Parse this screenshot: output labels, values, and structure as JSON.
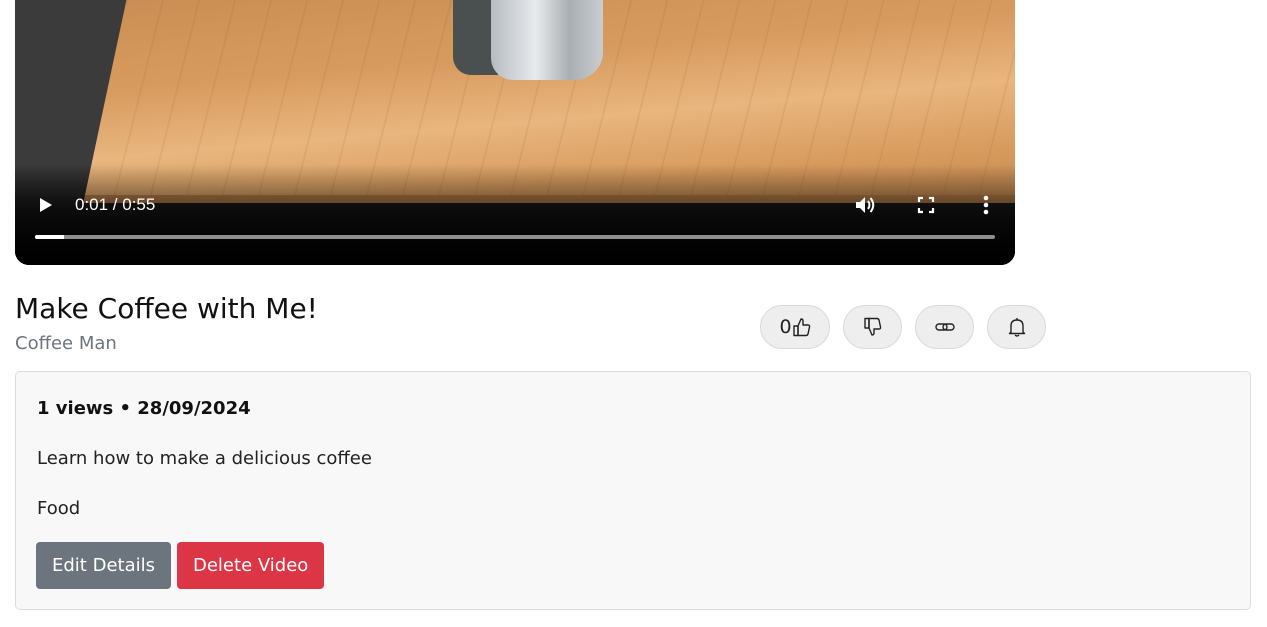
{
  "player": {
    "time": "0:01 / 0:55",
    "progress": 0.03,
    "play_icon": "play-icon",
    "volume_icon": "volume-icon",
    "fullscreen_icon": "fullscreen-icon",
    "more_icon": "more-vertical-icon"
  },
  "video": {
    "title": "Make Coffee with Me!",
    "channel": "Coffee Man",
    "likes": "0",
    "meta": "1 views • 28/09/2024",
    "description": "Learn how to make a delicious coffee",
    "category": "Food"
  },
  "actions": {
    "edit_label": "Edit Details",
    "delete_label": "Delete Video"
  },
  "colors": {
    "edit": "#6c757d",
    "delete": "#dc3545",
    "channel_text": "#6c757d"
  }
}
